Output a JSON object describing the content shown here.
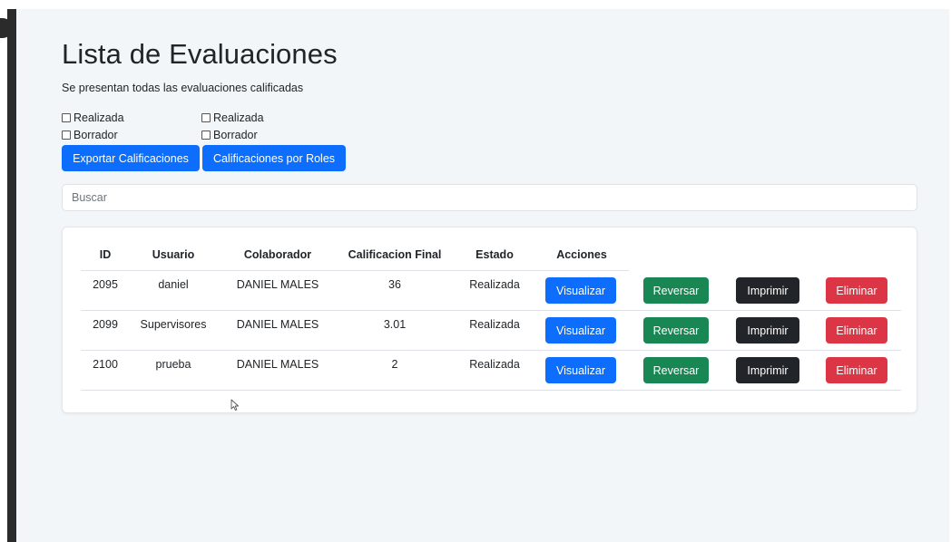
{
  "page": {
    "title": "Lista de Evaluaciones",
    "subtitle": "Se presentan todas las evaluaciones calificadas"
  },
  "filters": [
    {
      "label": "Realizada",
      "checked": false
    },
    {
      "label": "Borrador",
      "checked": false
    },
    {
      "label": "Realizada",
      "checked": false
    },
    {
      "label": "Borrador",
      "checked": false
    }
  ],
  "toolbar": {
    "export_label": "Exportar Calificaciones",
    "roles_label": "Calificaciones por Roles"
  },
  "search": {
    "placeholder": "Buscar"
  },
  "table": {
    "headers": {
      "id": "ID",
      "usuario": "Usuario",
      "colaborador": "Colaborador",
      "calificacion": "Calificacion Final",
      "estado": "Estado",
      "acciones": "Acciones"
    },
    "rows": [
      {
        "id": "2095",
        "usuario": "daniel",
        "colaborador": "DANIEL MALES",
        "calificacion": "36",
        "estado": "Realizada"
      },
      {
        "id": "2099",
        "usuario": "Supervisores",
        "colaborador": "DANIEL MALES",
        "calificacion": "3.01",
        "estado": "Realizada"
      },
      {
        "id": "2100",
        "usuario": "prueba",
        "colaborador": "DANIEL MALES",
        "calificacion": "2",
        "estado": "Realizada"
      }
    ],
    "actions": {
      "view": "Visualizar",
      "revert": "Reversar",
      "print": "Imprimir",
      "delete": "Eliminar"
    }
  },
  "colors": {
    "primary": "#0d6efd",
    "success": "#198754",
    "dark": "#212529",
    "danger": "#dc3545",
    "background": "#f3f6f9"
  }
}
